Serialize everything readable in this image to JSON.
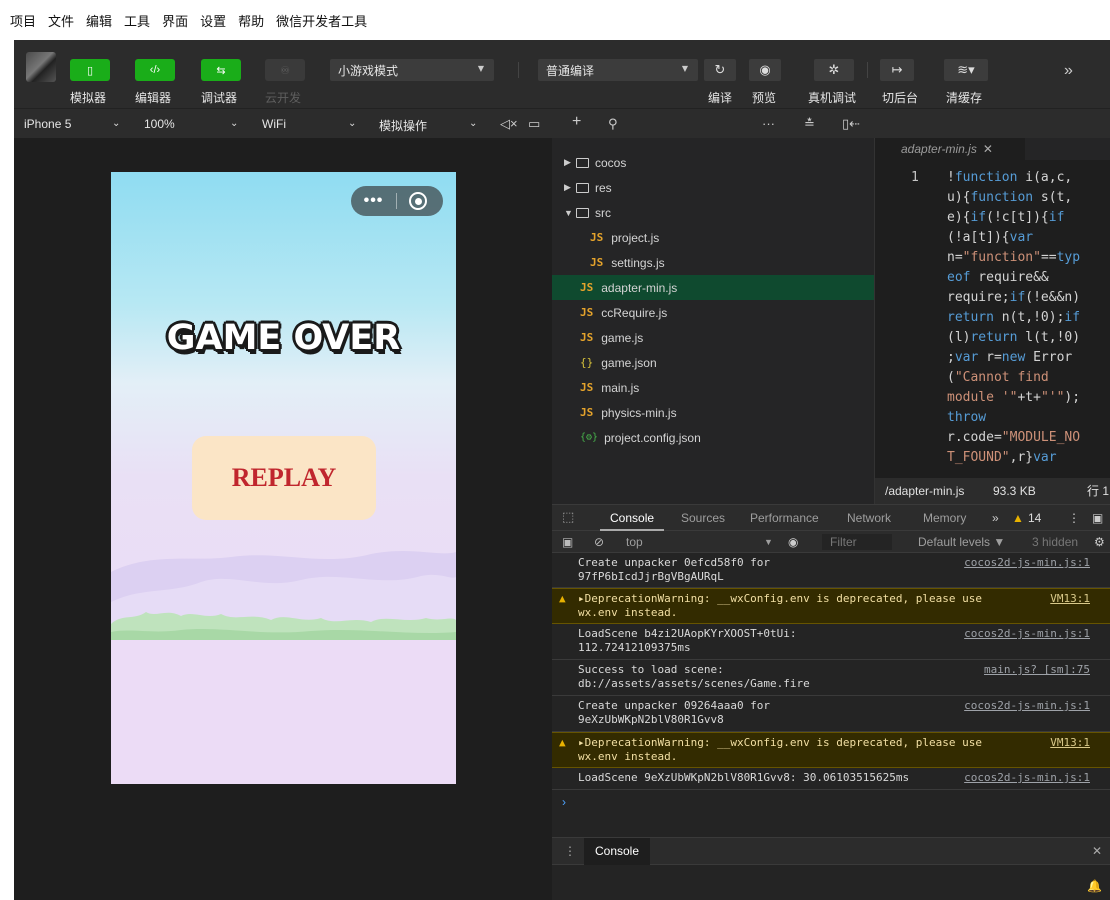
{
  "menu": [
    "项目",
    "文件",
    "编辑",
    "工具",
    "界面",
    "设置",
    "帮助",
    "微信开发者工具"
  ],
  "toolbar": {
    "simulator": "模拟器",
    "editor": "编辑器",
    "debugger": "调试器",
    "cloud": "云开发",
    "mode": "小游戏模式",
    "compile_mode": "普通编译",
    "compile": "编译",
    "preview": "预览",
    "device_debug": "真机调试",
    "background": "切后台",
    "clear_cache": "清缓存"
  },
  "subbar": {
    "device": "iPhone 5",
    "zoom": "100%",
    "network": "WiFi",
    "operation": "模拟操作"
  },
  "game": {
    "title": "GAME OVER",
    "replay": "REPLAY"
  },
  "tree": {
    "folders": [
      "cocos",
      "res",
      "src"
    ],
    "src_files": [
      "project.js",
      "settings.js"
    ],
    "files": [
      "adapter-min.js",
      "ccRequire.js",
      "game.js",
      "game.json",
      "main.js",
      "physics-min.js",
      "project.config.json"
    ]
  },
  "editor": {
    "tab": "adapter-min.js",
    "line_number": "1",
    "status_path": "/adapter-min.js",
    "status_size": "93.3 KB",
    "status_line": "行 1"
  },
  "devtools": {
    "tabs": [
      "Console",
      "Sources",
      "Performance",
      "Network",
      "Memory"
    ],
    "more": "»",
    "warn_count": "14",
    "context": "top",
    "filter_placeholder": "Filter",
    "levels": "Default levels ▼",
    "hidden": "3 hidden",
    "logs": [
      {
        "msg": "Create unpacker 0efcd58f0 for\n97fP6bIcdJjrBgVBgAURqL",
        "src": "cocos2d-js-min.js:1",
        "warn": false
      },
      {
        "msg": "▸DeprecationWarning: __wxConfig.env is deprecated, please use\nwx.env instead.",
        "src": "VM13:1",
        "warn": true
      },
      {
        "msg": "LoadScene b4zi2UAopKYrXOOST+0tUi:\n112.72412109375ms",
        "src": "cocos2d-js-min.js:1",
        "warn": false
      },
      {
        "msg": "Success to load scene:\ndb://assets/assets/scenes/Game.fire",
        "src": "main.js? [sm]:75",
        "warn": false
      },
      {
        "msg": "Create unpacker 09264aaa0 for\n9eXzUbWKpN2blV80R1Gvv8",
        "src": "cocos2d-js-min.js:1",
        "warn": false
      },
      {
        "msg": "▸DeprecationWarning: __wxConfig.env is deprecated, please use\nwx.env instead.",
        "src": "VM13:1",
        "warn": true
      },
      {
        "msg": "LoadScene 9eXzUbWKpN2blV80R1Gvv8: 30.06103515625ms",
        "src": "cocos2d-js-min.js:1",
        "warn": false
      }
    ],
    "drawer_tab": "Console"
  },
  "colors": {
    "accent": "#1aad19",
    "warn_bg": "#332b00",
    "tree_active": "#0f4a2f"
  }
}
